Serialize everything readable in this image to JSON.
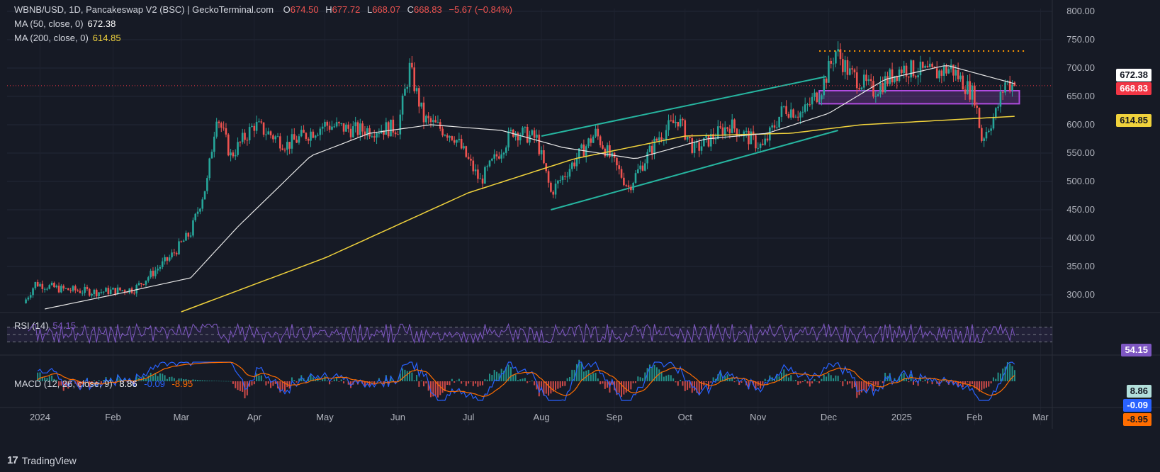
{
  "header": {
    "symbol": "WBNB/USD, 1D, Pancakeswap V2 (BSC) | GeckoTerminal.com",
    "o_label": "O",
    "o_value": "674.50",
    "h_label": "H",
    "h_value": "677.72",
    "l_label": "L",
    "l_value": "668.07",
    "c_label": "C",
    "c_value": "668.83",
    "change": "−5.67 (−0.84%)"
  },
  "ma50": {
    "label": "MA (50, close, 0)",
    "value": "672.38",
    "color": "#e8e8e8"
  },
  "ma200": {
    "label": "MA (200, close, 0)",
    "value": "614.85",
    "color": "#f0d23c"
  },
  "price_tag": {
    "value": "668.83",
    "color": "#f23645"
  },
  "rsi": {
    "label": "RSI (14)",
    "value": "54.15",
    "tag": "54.15",
    "color": "#7e57c2"
  },
  "macd": {
    "label": "MACD (12, 26, close, 9)",
    "macd": "8.86",
    "signal": "-0.09",
    "hist": "-8.95",
    "tag_macd": "8.86",
    "tag_signal": "-0.09",
    "tag_hist": "-8.95"
  },
  "brand": {
    "name": "TradingView"
  },
  "colors": {
    "up": "#26a69a",
    "down": "#ef5350",
    "channel": "#26b5a0",
    "zone": "#b04ce0",
    "resistance": "#ff9800"
  },
  "chart_data": {
    "type": "candlestick",
    "title": "WBNB/USD, 1D, Pancakeswap V2 (BSC) | GeckoTerminal.com",
    "y_ticks": [
      "800.00",
      "750.00",
      "700.00",
      "650.00",
      "600.00",
      "550.00",
      "500.00",
      "450.00",
      "400.00",
      "350.00",
      "300.00"
    ],
    "ylim": [
      270,
      805
    ],
    "x_ticks": [
      "2024",
      "Feb",
      "Mar",
      "Apr",
      "May",
      "Jun",
      "Jul",
      "Aug",
      "Sep",
      "Oct",
      "Nov",
      "Dec",
      "2025",
      "Feb",
      "Mar"
    ],
    "anchors": [
      {
        "date": "2023-12-25",
        "price": 285
      },
      {
        "date": "2023-12-30",
        "price": 320
      },
      {
        "date": "2024-01-10",
        "price": 310
      },
      {
        "date": "2024-01-25",
        "price": 305
      },
      {
        "date": "2024-02-10",
        "price": 310
      },
      {
        "date": "2024-02-25",
        "price": 365
      },
      {
        "date": "2024-03-05",
        "price": 410
      },
      {
        "date": "2024-03-12",
        "price": 500
      },
      {
        "date": "2024-03-16",
        "price": 620
      },
      {
        "date": "2024-03-22",
        "price": 545
      },
      {
        "date": "2024-04-01",
        "price": 600
      },
      {
        "date": "2024-04-15",
        "price": 565
      },
      {
        "date": "2024-05-01",
        "price": 600
      },
      {
        "date": "2024-05-15",
        "price": 590
      },
      {
        "date": "2024-06-01",
        "price": 595
      },
      {
        "date": "2024-06-06",
        "price": 700
      },
      {
        "date": "2024-06-12",
        "price": 610
      },
      {
        "date": "2024-06-25",
        "price": 580
      },
      {
        "date": "2024-07-06",
        "price": 500
      },
      {
        "date": "2024-07-20",
        "price": 590
      },
      {
        "date": "2024-07-30",
        "price": 575
      },
      {
        "date": "2024-08-05",
        "price": 480
      },
      {
        "date": "2024-08-14",
        "price": 530
      },
      {
        "date": "2024-08-24",
        "price": 585
      },
      {
        "date": "2024-09-07",
        "price": 490
      },
      {
        "date": "2024-09-20",
        "price": 580
      },
      {
        "date": "2024-09-28",
        "price": 610
      },
      {
        "date": "2024-10-05",
        "price": 555
      },
      {
        "date": "2024-10-20",
        "price": 600
      },
      {
        "date": "2024-11-03",
        "price": 560
      },
      {
        "date": "2024-11-12",
        "price": 630
      },
      {
        "date": "2024-11-20",
        "price": 620
      },
      {
        "date": "2024-11-28",
        "price": 665
      },
      {
        "date": "2024-12-04",
        "price": 730
      },
      {
        "date": "2024-12-10",
        "price": 690
      },
      {
        "date": "2024-12-20",
        "price": 660
      },
      {
        "date": "2025-01-01",
        "price": 700
      },
      {
        "date": "2025-01-15",
        "price": 690
      },
      {
        "date": "2025-01-22",
        "price": 700
      },
      {
        "date": "2025-02-01",
        "price": 650
      },
      {
        "date": "2025-02-04",
        "price": 575
      },
      {
        "date": "2025-02-10",
        "price": 620
      },
      {
        "date": "2025-02-14",
        "price": 675
      },
      {
        "date": "2025-02-18",
        "price": 668.83
      }
    ],
    "ma50_anchors": [
      {
        "date": "2024-01-03",
        "price": 275
      },
      {
        "date": "2024-02-01",
        "price": 300
      },
      {
        "date": "2024-03-05",
        "price": 330
      },
      {
        "date": "2024-03-25",
        "price": 420
      },
      {
        "date": "2024-04-25",
        "price": 545
      },
      {
        "date": "2024-05-20",
        "price": 585
      },
      {
        "date": "2024-06-15",
        "price": 600
      },
      {
        "date": "2024-07-15",
        "price": 590
      },
      {
        "date": "2024-08-10",
        "price": 560
      },
      {
        "date": "2024-09-10",
        "price": 540
      },
      {
        "date": "2024-10-10",
        "price": 575
      },
      {
        "date": "2024-11-05",
        "price": 585
      },
      {
        "date": "2024-12-01",
        "price": 620
      },
      {
        "date": "2024-12-25",
        "price": 680
      },
      {
        "date": "2025-01-20",
        "price": 705
      },
      {
        "date": "2025-02-18",
        "price": 672.38
      }
    ],
    "ma200_anchors": [
      {
        "date": "2024-03-01",
        "price": 270
      },
      {
        "date": "2024-05-01",
        "price": 365
      },
      {
        "date": "2024-07-01",
        "price": 480
      },
      {
        "date": "2024-08-15",
        "price": 540
      },
      {
        "date": "2024-10-01",
        "price": 580
      },
      {
        "date": "2024-11-15",
        "price": 585
      },
      {
        "date": "2024-12-15",
        "price": 600
      },
      {
        "date": "2025-02-18",
        "price": 614.85
      }
    ],
    "channel": {
      "upper": [
        {
          "date": "2024-08-01",
          "price": 580
        },
        {
          "date": "2024-11-30",
          "price": 685
        }
      ],
      "lower": [
        {
          "date": "2024-08-05",
          "price": 450
        },
        {
          "date": "2024-12-05",
          "price": 590
        }
      ]
    },
    "resistance": {
      "price": 730,
      "from": "2024-11-27",
      "to": "2025-02-22"
    },
    "zone": {
      "top": 660,
      "bottom": 637,
      "from": "2024-11-27",
      "to": "2025-02-20"
    },
    "rsi_levels": [
      70,
      50,
      30
    ],
    "macd_summary": {
      "macd": 8.86,
      "signal": -0.09,
      "histogram": -8.95
    }
  }
}
